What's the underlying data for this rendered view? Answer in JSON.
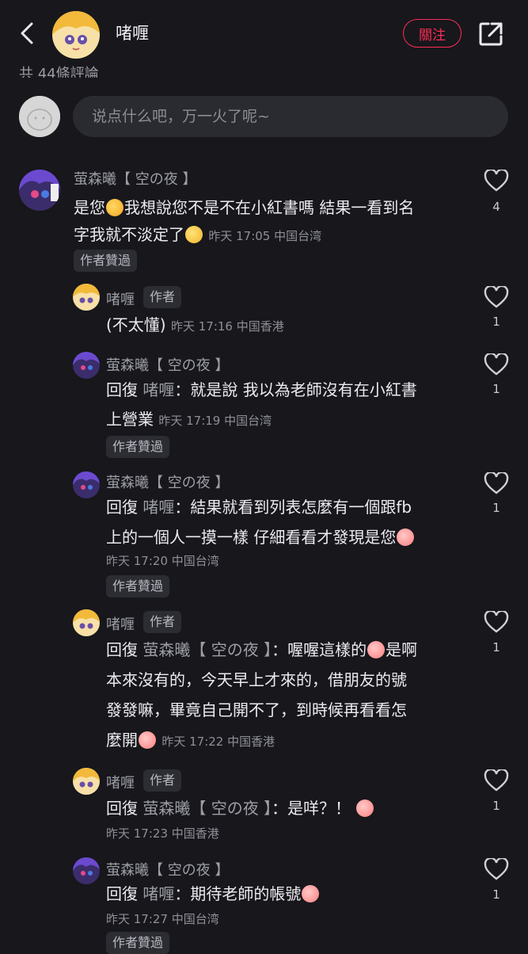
{
  "header": {
    "author_name": "啫喱",
    "follow_label": "關注"
  },
  "comment_count_text": "共 44條評論",
  "input": {
    "placeholder": "说点什么吧，万一火了呢~"
  },
  "comments": [
    {
      "user": "萤森曦【 空の夜 】",
      "line1": "是您",
      "line1b": "我想說您不是不在小紅書嗎 結果一看到名",
      "line2": "字我就不淡定了",
      "time": "昨天 17:05 中国台湾",
      "tag": "作者贊過",
      "likes": "4"
    }
  ],
  "replies": [
    {
      "user": "啫喱",
      "badge": "作者",
      "text": "(不太懂)",
      "time": "昨天 17:16 中国香港",
      "likes": "1"
    },
    {
      "user": "萤森曦【 空の夜 】",
      "prefix": "回復",
      "target": "啫喱",
      "l1": "：就是說 我以為老師沒有在小紅書",
      "l2": "上營業",
      "time": "昨天 17:19 中国台湾",
      "tag": "作者贊過",
      "likes": "1"
    },
    {
      "user": "萤森曦【 空の夜 】",
      "prefix": "回復",
      "target": "啫喱",
      "l1": "：結果就看到列表怎麼有一個跟fb",
      "l2": "上的一個人一摸一樣 仔細看看才發現是您",
      "time": "昨天 17:20 中国台湾",
      "tag": "作者贊過",
      "likes": "1"
    },
    {
      "user": "啫喱",
      "badge": "作者",
      "prefix": "回復",
      "target": "萤森曦【 空の夜 】",
      "l1": "：喔喔這樣的",
      "l1b": "是啊",
      "l2": "本來沒有的，今天早上才來的，借朋友的號",
      "l3": "發發嘛，畢竟自己開不了，到時候再看看怎",
      "l4": "麼開",
      "time": "昨天 17:22 中国香港",
      "likes": "1"
    },
    {
      "user": "啫喱",
      "badge": "作者",
      "prefix": "回復",
      "target": "萤森曦【 空の夜 】",
      "l1": "：是咩？！",
      "time": "昨天 17:23 中国香港",
      "likes": "1"
    },
    {
      "user": "萤森曦【 空の夜 】",
      "prefix": "回復",
      "target": "啫喱",
      "l1": "：期待老師的帳號",
      "time": "昨天 17:27 中国台湾",
      "tag": "作者贊過",
      "likes": "1"
    }
  ],
  "colors": {
    "background": "#17171c",
    "accent": "#ff2c55",
    "input_bg": "#2a2a31"
  }
}
